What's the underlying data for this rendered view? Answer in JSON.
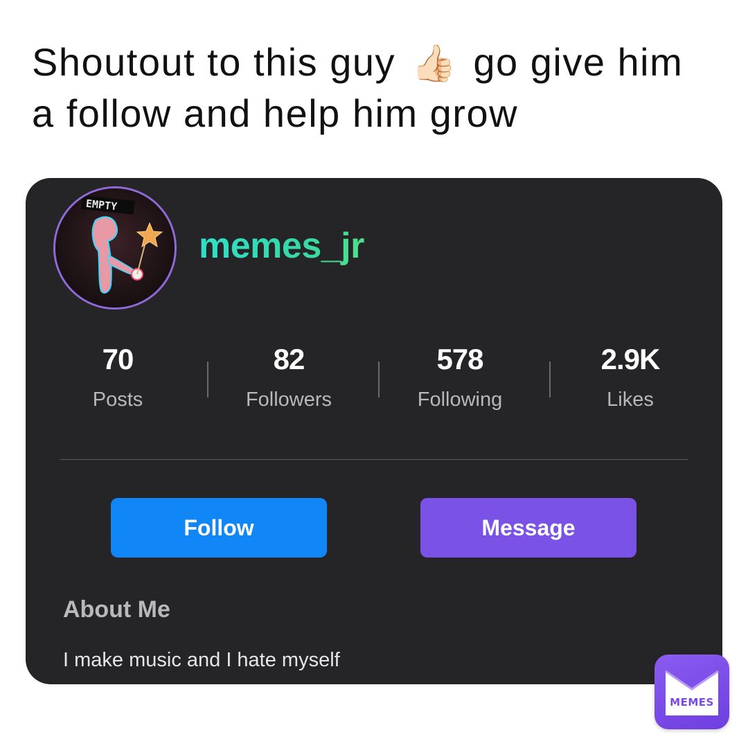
{
  "caption": {
    "text_before": "Shoutout to this guy",
    "emoji": "👍🏻",
    "text_after": "go give him a follow and help him grow"
  },
  "profile": {
    "avatar_label": "EMPTY",
    "username": "memes_jr",
    "username_color": "#33dcbe"
  },
  "stats": [
    {
      "value": "70",
      "label": "Posts"
    },
    {
      "value": "82",
      "label": "Followers"
    },
    {
      "value": "578",
      "label": "Following"
    },
    {
      "value": "2.9K",
      "label": "Likes"
    }
  ],
  "actions": {
    "follow_label": "Follow",
    "follow_color": "#1186f7",
    "message_label": "Message",
    "message_color": "#7a52e6"
  },
  "about": {
    "title": "About Me",
    "text": "I make music and I hate myself"
  },
  "watermark": {
    "label": "MEMES",
    "icon": "envelope-icon",
    "color": "#7a4ae8"
  }
}
